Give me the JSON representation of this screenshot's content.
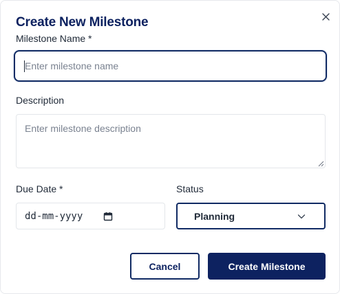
{
  "dialog": {
    "title": "Create New Milestone",
    "close_icon": "close-icon"
  },
  "form": {
    "name": {
      "label": "Milestone Name *",
      "placeholder": "Enter milestone name",
      "value": ""
    },
    "description": {
      "label": "Description",
      "placeholder": "Enter milestone description",
      "value": ""
    },
    "due_date": {
      "label": "Due Date *",
      "placeholder": "dd-mm-yyyy",
      "icon": "calendar-icon"
    },
    "status": {
      "label": "Status",
      "selected": "Planning",
      "icon": "chevron-down-icon"
    }
  },
  "actions": {
    "cancel_label": "Cancel",
    "create_label": "Create Milestone"
  },
  "colors": {
    "brand": "#0d2260",
    "border": "#e3e6ea",
    "text": "#1f2937",
    "placeholder": "#7a8290"
  }
}
